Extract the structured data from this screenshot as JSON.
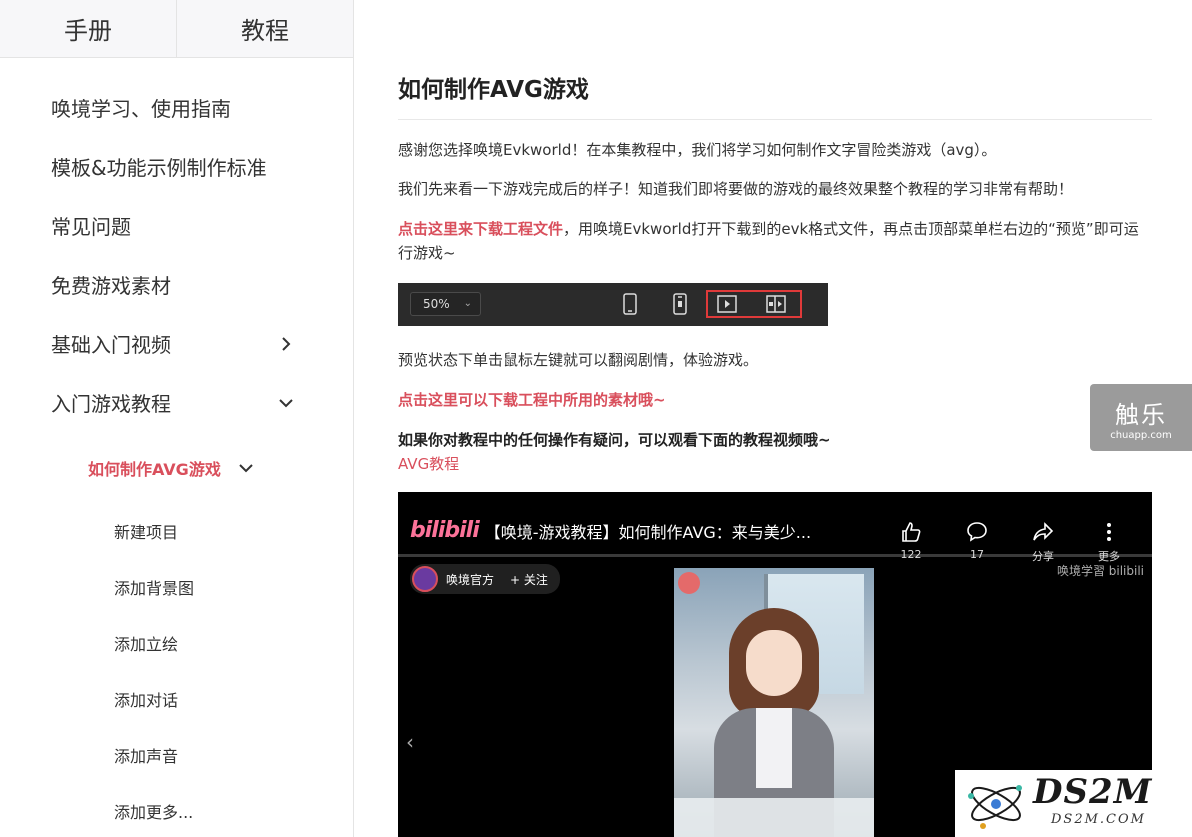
{
  "sidebar": {
    "tabs": [
      {
        "label": "手册"
      },
      {
        "label": "教程"
      }
    ],
    "items": [
      {
        "label": "唤境学习、使用指南"
      },
      {
        "label": "模板&功能示例制作标准"
      },
      {
        "label": "常见问题"
      },
      {
        "label": "免费游戏素材"
      },
      {
        "label": "基础入门视频"
      },
      {
        "label": "入门游戏教程"
      }
    ],
    "active_sub": {
      "label": "如何制作AVG游戏"
    },
    "leaves": [
      {
        "label": "新建项目"
      },
      {
        "label": "添加背景图"
      },
      {
        "label": "添加立绘"
      },
      {
        "label": "添加对话"
      },
      {
        "label": "添加声音"
      },
      {
        "label": "添加更多..."
      }
    ]
  },
  "article": {
    "title": "如何制作AVG游戏",
    "p1": "感谢您选择唤境Evkworld！在本集教程中，我们将学习如何制作文字冒险类游戏（avg）。",
    "p2": "我们先来看一下游戏完成后的样子！知道我们即将要做的游戏的最终效果整个教程的学习非常有帮助！",
    "p3_link": "点击这里来下载工程文件",
    "p3_rest": "，用唤境Evkworld打开下载到的evk格式文件，再点击顶部菜单栏右边的“预览”即可运行游戏~",
    "toolbar_zoom": "50%",
    "p4": "预览状态下单击鼠标左键就可以翻阅剧情，体验游戏。",
    "p5_link": "点击这里可以下载工程中所用的素材哦~",
    "p6": "如果你对教程中的任何操作有疑问，可以观看下面的教程视频哦~",
    "p7_link": "AVG教程"
  },
  "video": {
    "logo": "bilibili",
    "title": "【唤境-游戏教程】如何制作AVG：来与美少...",
    "like_count": "122",
    "comment_count": "17",
    "share_label": "分享",
    "more_label": "更多",
    "channel_name": "唤境官方",
    "follow_label": "+ 关注",
    "watermark": "唤境学習 bilibili"
  },
  "floating": {
    "chuapp_title": "触乐",
    "chuapp_url": "chuapp.com"
  },
  "watermark": {
    "logo": "DS2M",
    "url": "DS2M.COM"
  },
  "colors": {
    "accent": "#d94f5c",
    "toolbar_bg": "#2b2b2b",
    "highlight": "#e03a3a"
  }
}
